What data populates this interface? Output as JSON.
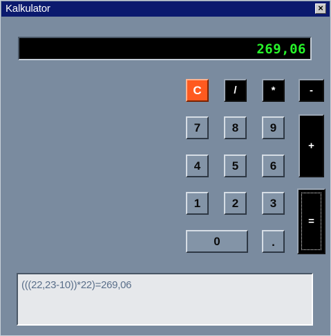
{
  "window": {
    "title": "Kalkulator",
    "close_icon": "close-icon"
  },
  "display": {
    "value": "269,06"
  },
  "keys": {
    "clear": "C",
    "divide": "/",
    "multiply": "*",
    "minus": "-",
    "plus": "+",
    "equals": "=",
    "seven": "7",
    "eight": "8",
    "nine": "9",
    "four": "4",
    "five": "5",
    "six": "6",
    "one": "1",
    "two": "2",
    "three": "3",
    "zero": "0",
    "decimal": "."
  },
  "history": {
    "text": "(((22,23-10))*22)=269,06"
  },
  "colors": {
    "titlebar": "#0b1a6e",
    "display_text": "#27f52a",
    "clear_button": "#ff5a1f",
    "operator_button": "#000000",
    "body": "#7a8b9f"
  }
}
